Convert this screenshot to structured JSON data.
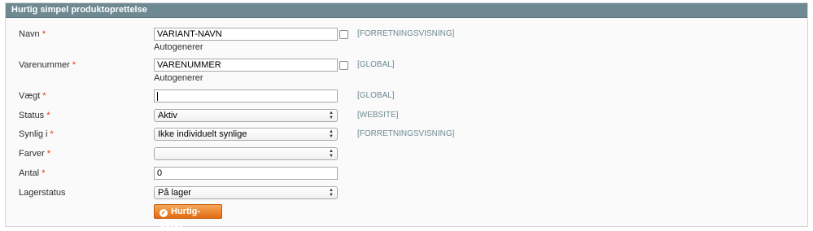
{
  "section": {
    "title": "Hurtig simpel produktoprettelse"
  },
  "fields": {
    "navn": {
      "label": "Navn",
      "required_mark": "*",
      "value": "VARIANT-NAVN",
      "autogen_label": "Autogenerer",
      "scope": "[FORRETNINGSVISNING]"
    },
    "varenummer": {
      "label": "Varenummer",
      "required_mark": "*",
      "value": "VARENUMMER",
      "autogen_label": "Autogenerer",
      "scope": "[GLOBAL]"
    },
    "vaegt": {
      "label": "Vægt",
      "required_mark": "*",
      "value": "",
      "scope": "[GLOBAL]"
    },
    "status": {
      "label": "Status",
      "required_mark": "*",
      "selected": "Aktiv",
      "scope": "[WEBSITE]"
    },
    "synlig": {
      "label": "Synlig i",
      "required_mark": "*",
      "selected": "Ikke individuelt synlige",
      "scope": "[FORRETNINGSVISNING]"
    },
    "farver": {
      "label": "Farver",
      "required_mark": "*",
      "selected": ""
    },
    "antal": {
      "label": "Antal",
      "required_mark": "*",
      "value": "0"
    },
    "lagerstatus": {
      "label": "Lagerstatus",
      "selected": "På lager"
    }
  },
  "button": {
    "label": "Hurtig-opret",
    "icon": "check-circle-icon"
  },
  "colors": {
    "header_bg": "#6f8992",
    "required": "#eb340a",
    "button": "#e26b12",
    "scope_text": "#6f8992"
  }
}
